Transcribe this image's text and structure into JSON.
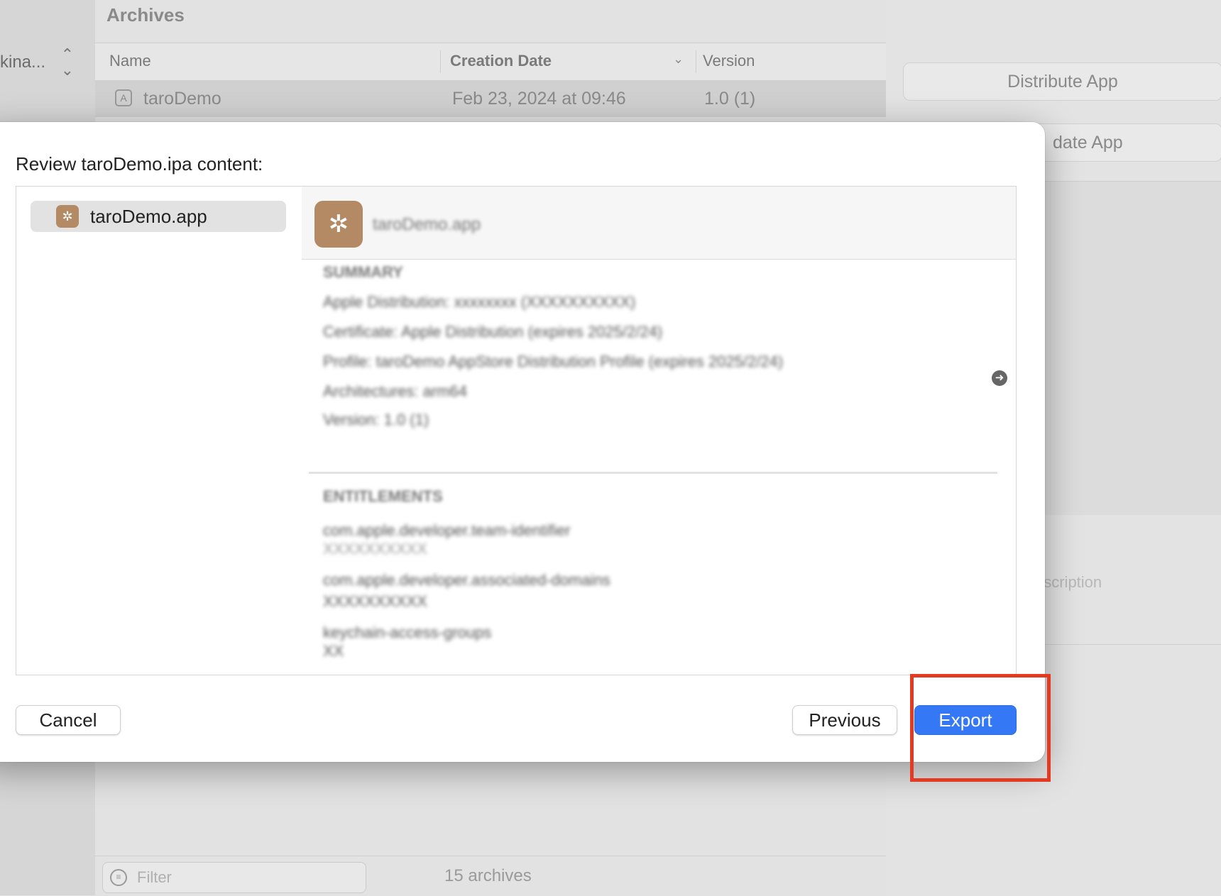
{
  "background": {
    "scheme_label": "kina...",
    "archives_title": "Archives",
    "columns": {
      "name": "Name",
      "creation_date": "Creation Date",
      "version": "Version"
    },
    "archive_row": {
      "name": "taroDemo",
      "date": "Feb 23, 2024 at 09:46",
      "version": "1.0 (1)"
    },
    "filter_placeholder": "Filter",
    "archive_count": "15 archives",
    "distribute_button": "Distribute App",
    "validate_button_partial": "date App",
    "description_hint_partial": "escription"
  },
  "dialog": {
    "title": "Review taroDemo.ipa content:",
    "nav_items": [
      {
        "label": "taroDemo.app"
      }
    ],
    "detail": {
      "header_name": "taroDemo.app",
      "summary": {
        "title": "SUMMARY",
        "lines": [
          "Apple Distribution: xxxxxxxx (XXXXXXXXXX)",
          "Certificate: Apple Distribution (expires 2025/2/24)",
          "Profile: taroDemo AppStore Distribution Profile (expires 2025/2/24)",
          "Architectures: arm64",
          "Version: 1.0 (1)"
        ]
      },
      "entitlements": {
        "title": "ENTITLEMENTS",
        "items": [
          {
            "key": "com.apple.developer.team-identifier",
            "value": "XXXXXXXXXX"
          },
          {
            "key": "com.apple.developer.associated-domains",
            "value": "XXXXXXXXXX"
          },
          {
            "key": "keychain-access-groups",
            "value": "XX"
          }
        ]
      }
    },
    "buttons": {
      "cancel": "Cancel",
      "previous": "Previous",
      "export": "Export"
    }
  }
}
